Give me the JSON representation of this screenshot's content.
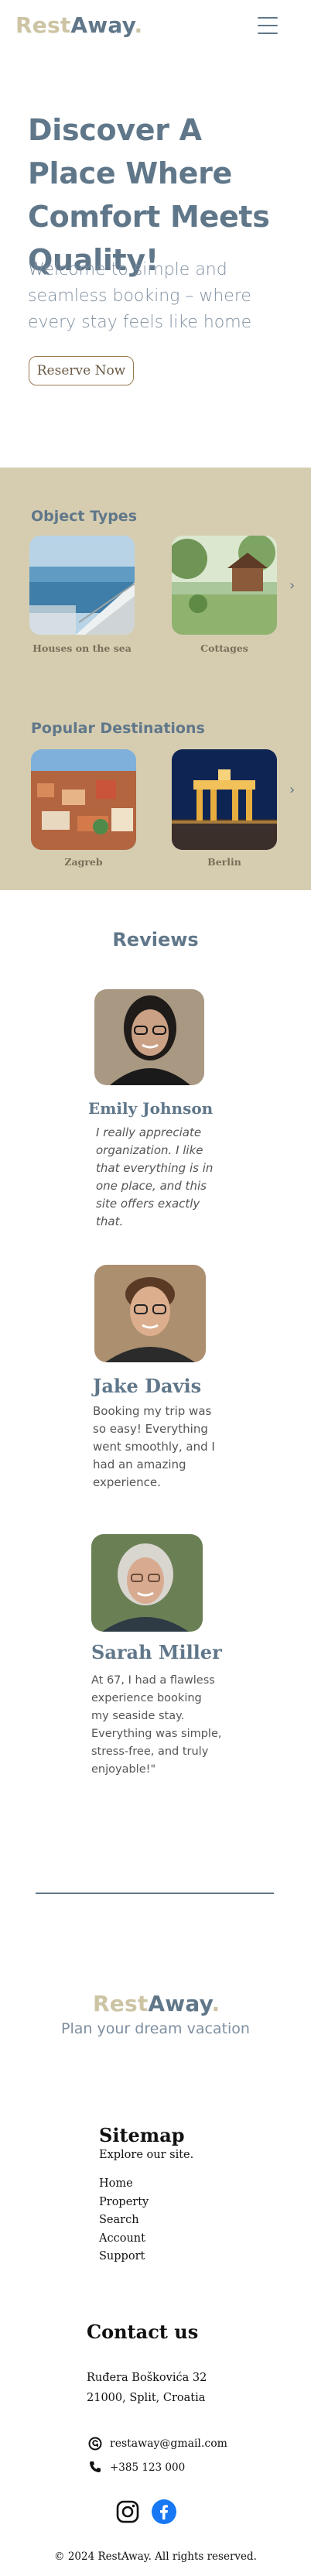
{
  "header": {
    "logo_rest": "Rest",
    "logo_away": "Away",
    "logo_dot": "."
  },
  "hero": {
    "title": "Discover A Place Where Comfort Meets Quality!",
    "subtitle": "Welcome to simple and seamless booking – where every stay feels like home",
    "cta": "Reserve Now"
  },
  "object_types": {
    "heading": "Object Types",
    "items": [
      {
        "label": "Houses on the sea"
      },
      {
        "label": "Cottages"
      }
    ]
  },
  "destinations": {
    "heading": "Popular Destinations",
    "items": [
      {
        "label": "Zagreb"
      },
      {
        "label": "Berlin"
      }
    ]
  },
  "reviews": {
    "heading": "Reviews",
    "items": [
      {
        "name": "Emily Johnson",
        "text": "I really appreciate organization. I like that everything is in one place, and this site offers exactly that."
      },
      {
        "name": "Jake Davis",
        "text": "Booking my trip was so easy! Everything went smoothly, and I had an amazing experience."
      },
      {
        "name": "Sarah Miller",
        "text": "At 67, I had a flawless experience booking my seaside stay. Everything was simple, stress-free, and truly enjoyable!\""
      }
    ]
  },
  "footer": {
    "tagline": "Plan your dream vacation",
    "sitemap_title": "Sitemap",
    "sitemap_sub": "Explore our site.",
    "links": [
      "Home",
      "Property",
      "Search",
      "Account",
      "Support"
    ],
    "contact_title": "Contact us",
    "address_line1": "Ruđera Boškovića 32",
    "address_line2": "21000, Split, Croatia",
    "email": "restaway@gmail.com",
    "phone": "+385 123 000",
    "copyright": "© 2024 RestAway. All rights reserved."
  },
  "colors": {
    "brand_blue": "#60778a",
    "brand_beige": "#d6cdb1",
    "icons": [
      "menu-icon",
      "chevron-right-icon",
      "email-icon",
      "phone-icon",
      "instagram-icon",
      "facebook-icon"
    ]
  }
}
